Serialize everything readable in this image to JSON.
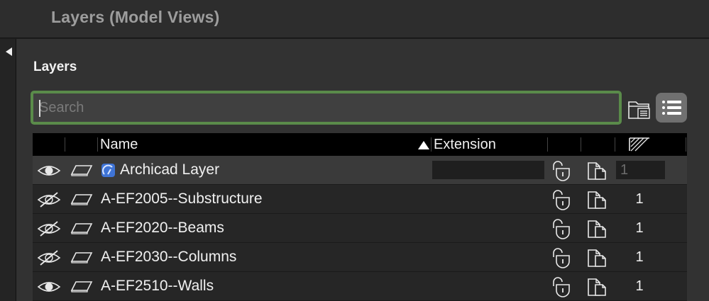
{
  "window": {
    "title": "Layers (Model Views)"
  },
  "section": {
    "label": "Layers"
  },
  "search": {
    "placeholder": "Search",
    "value": ""
  },
  "table": {
    "columns": {
      "name": "Name",
      "extension": "Extension"
    },
    "sort": {
      "column": "name",
      "direction": "ascending"
    },
    "rows": [
      {
        "visible": true,
        "name": "Archicad Layer",
        "extension": "",
        "intersection_group": "1",
        "locked": false,
        "is_archicad_layer": true
      },
      {
        "visible": false,
        "name": "A-EF2005--Substructure",
        "extension": "",
        "intersection_group": "1",
        "locked": false
      },
      {
        "visible": false,
        "name": "A-EF2020--Beams",
        "extension": "",
        "intersection_group": "1",
        "locked": false
      },
      {
        "visible": false,
        "name": "A-EF2030--Columns",
        "extension": "",
        "intersection_group": "1",
        "locked": false
      },
      {
        "visible": true,
        "name": "A-EF2510--Walls",
        "extension": "",
        "intersection_group": "1",
        "locked": false
      }
    ]
  },
  "icons": {
    "visible": "eye-icon",
    "hidden": "eye-slash-icon",
    "plane": "layer-plane-icon",
    "lock": "padlock-icon",
    "cube": "solid-box-icon",
    "hatch": "intersection-group-icon",
    "new_folder": "new-folder-icon",
    "list_view": "list-view-icon"
  },
  "colors": {
    "search_focus": "#5a8b4a",
    "archicad_icon": "#3f74d6"
  }
}
